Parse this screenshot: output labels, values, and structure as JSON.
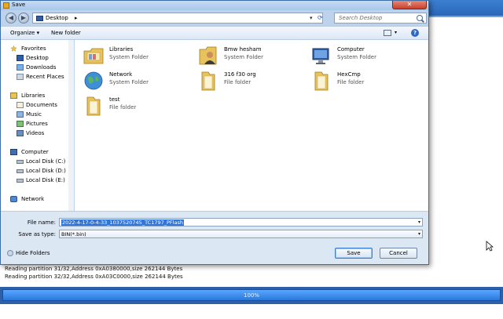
{
  "dialog": {
    "title": "Save",
    "close_glyph": "✕",
    "address": {
      "location": "Desktop",
      "separator": "▸",
      "dropdown_glyph": "▾",
      "refresh_glyph": "⟳",
      "search_placeholder": "Search Desktop"
    },
    "nav_buttons": {
      "back_glyph": "◀",
      "forward_glyph": "▶"
    },
    "toolbar": {
      "organize_label": "Organize ▾",
      "new_folder_label": "New folder",
      "view_drop_glyph": "▾",
      "help_glyph": "?"
    },
    "navigation": [
      {
        "label": "Favorites",
        "icon": "star-icon",
        "header": true
      },
      {
        "label": "Desktop",
        "icon": "desktop-icon"
      },
      {
        "label": "Downloads",
        "icon": "downloads-icon"
      },
      {
        "label": "Recent Places",
        "icon": "recent-places-icon"
      },
      {
        "label": "Libraries",
        "icon": "libraries-icon",
        "header": true
      },
      {
        "label": "Documents",
        "icon": "documents-icon"
      },
      {
        "label": "Music",
        "icon": "music-icon"
      },
      {
        "label": "Pictures",
        "icon": "pictures-icon"
      },
      {
        "label": "Videos",
        "icon": "videos-icon"
      },
      {
        "label": "Computer",
        "icon": "computer-icon",
        "header": true
      },
      {
        "label": "Local Disk (C:)",
        "icon": "disk-icon"
      },
      {
        "label": "Local Disk (D:)",
        "icon": "disk-icon"
      },
      {
        "label": "Local Disk (E:)",
        "icon": "disk-icon"
      },
      {
        "label": "Network",
        "icon": "network-icon",
        "header": true
      }
    ],
    "items": [
      {
        "name": "Libraries",
        "type": "System Folder",
        "icon": "libraries-folder-icon"
      },
      {
        "name": "Bmw hesham",
        "type": "System Folder",
        "icon": "user-folder-icon"
      },
      {
        "name": "Computer",
        "type": "System Folder",
        "icon": "computer-icon"
      },
      {
        "name": "Network",
        "type": "System Folder",
        "icon": "network-globe-icon"
      },
      {
        "name": "316 f30 org",
        "type": "File folder",
        "icon": "folder-icon"
      },
      {
        "name": "HexCmp",
        "type": "File folder",
        "icon": "folder-icon"
      },
      {
        "name": "test",
        "type": "File folder",
        "icon": "folder-icon"
      }
    ],
    "form": {
      "filename_label": "File name:",
      "filename_value": "2022-4-17-0-4-33_1037520745_TC1797_PFlash",
      "savetype_label": "Save as type:",
      "savetype_value": "BIN(*.bin)",
      "dropdown_glyph": "▾"
    },
    "buttons": {
      "hide_folders": "Hide Folders",
      "save": "Save",
      "cancel": "Cancel"
    }
  },
  "background": {
    "log_lines": [
      "Reading partition 31/32,Address 0xA0380000,size 262144 Bytes",
      "Reading partition 32/32,Address 0xA03C0000,size 262144 Bytes"
    ],
    "progress_label": "100%",
    "progress_fraction": 1.0
  },
  "colors": {
    "accent": "#3b7fd0",
    "selection": "#3376d6",
    "close": "#c8402b"
  }
}
